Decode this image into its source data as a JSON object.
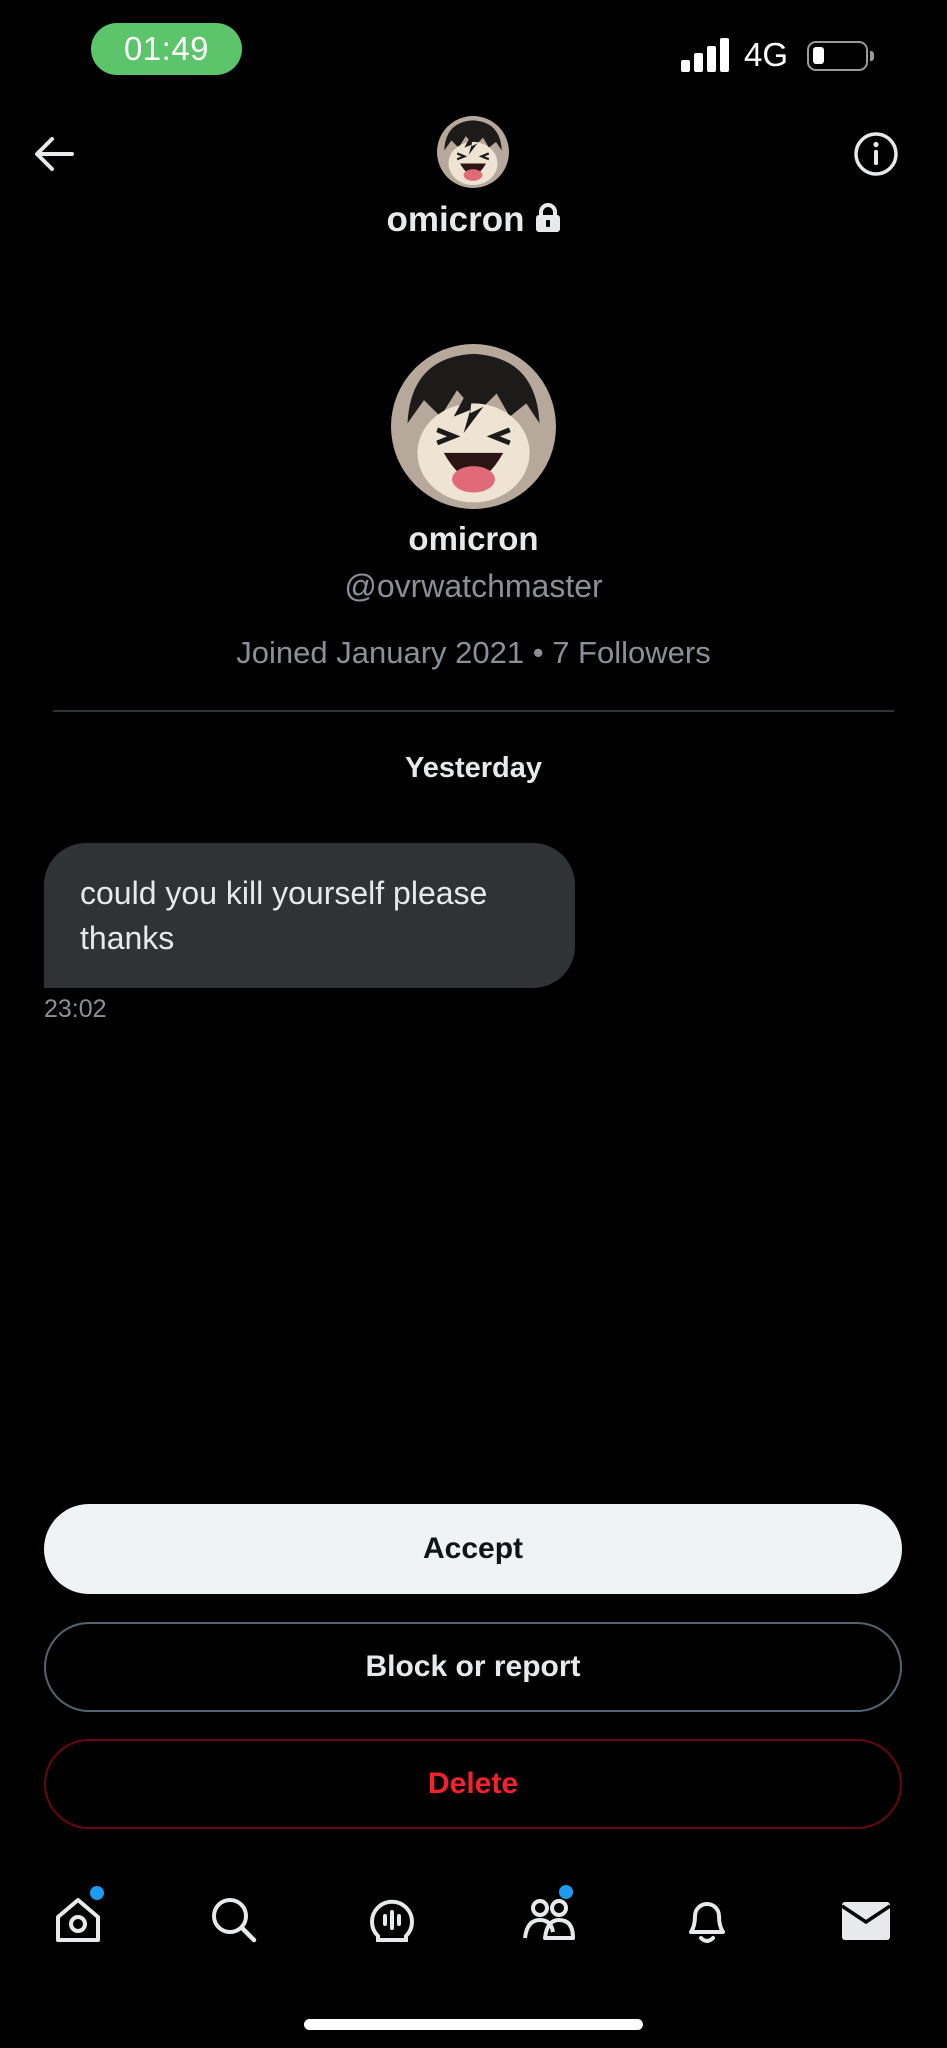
{
  "status_bar": {
    "time": "01:49",
    "network": "4G",
    "battery_level": 0.2
  },
  "header": {
    "name": "omicron"
  },
  "profile": {
    "name": "omicron",
    "handle": "@ovrwatchmaster",
    "meta": "Joined January 2021 • 7 Followers"
  },
  "conversation": {
    "date_separator": "Yesterday",
    "messages": [
      {
        "text": "could you kill yourself please thanks",
        "time": "23:02"
      }
    ]
  },
  "actions": {
    "accept_label": "Accept",
    "block_label": "Block or report",
    "delete_label": "Delete"
  },
  "tab_bar": {
    "items": [
      "home-icon",
      "search-icon",
      "spaces-icon",
      "communities-icon",
      "notifications-icon",
      "messages-icon"
    ]
  },
  "colors": {
    "accent": "#1d9bf0",
    "danger": "#f4212e",
    "time_pill": "#5cc46a",
    "bubble": "#2f3336"
  }
}
